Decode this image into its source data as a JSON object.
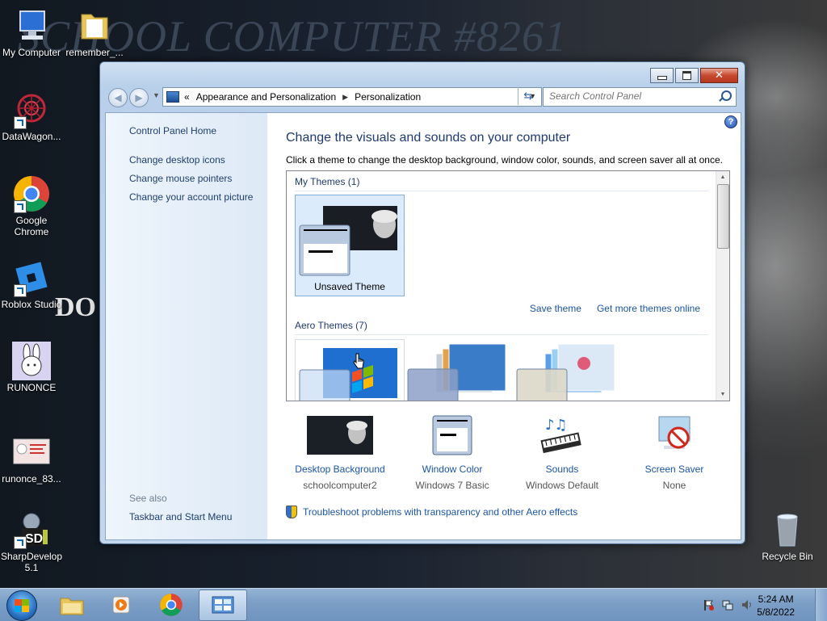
{
  "desktop": {
    "wallpaper_text": "SCHOOL COMPUTER #8261",
    "wallpaper_side_text": "DO",
    "icons": [
      {
        "label": "My Computer"
      },
      {
        "label": "remember_..."
      },
      {
        "label": "DataWagon..."
      },
      {
        "label": "Google Chrome"
      },
      {
        "label": "Roblox Studio"
      },
      {
        "label": "RUNONCE"
      },
      {
        "label": "runonce_83..."
      },
      {
        "label": "SharpDevelop 5.1"
      },
      {
        "label": "Recycle Bin"
      }
    ]
  },
  "window": {
    "breadcrumb": {
      "prefix": "«",
      "items": [
        "Appearance and Personalization",
        "Personalization"
      ]
    },
    "search_placeholder": "Search Control Panel",
    "help_glyph": "?",
    "left_nav": {
      "home": "Control Panel Home",
      "links": [
        "Change desktop icons",
        "Change mouse pointers",
        "Change your account picture"
      ],
      "see_also_title": "See also",
      "see_also": [
        "Taskbar and Start Menu"
      ]
    },
    "main": {
      "title": "Change the visuals and sounds on your computer",
      "subtitle": "Click a theme to change the desktop background, window color, sounds, and screen saver all at once.",
      "my_themes_label": "My Themes (1)",
      "my_themes": [
        {
          "name": "Unsaved Theme",
          "selected": true
        }
      ],
      "save_theme": "Save theme",
      "get_more": "Get more themes online",
      "aero_themes_label": "Aero Themes (7)",
      "bottom_items": [
        {
          "name": "Desktop Background",
          "value": "schoolcomputer2",
          "icon": "desktop-background-icon"
        },
        {
          "name": "Window Color",
          "value": "Windows 7 Basic",
          "icon": "window-color-icon"
        },
        {
          "name": "Sounds",
          "value": "Windows Default",
          "icon": "sounds-icon"
        },
        {
          "name": "Screen Saver",
          "value": "None",
          "icon": "screen-saver-icon"
        }
      ],
      "troubleshoot": "Troubleshoot problems with transparency and other Aero effects"
    }
  },
  "taskbar": {
    "time": "5:24 AM",
    "date": "5/8/2022",
    "pinned": [
      "windows-explorer-icon",
      "media-player-icon",
      "chrome-icon",
      "control-panel-icon"
    ],
    "active_index": 3
  },
  "colors": {
    "link": "#1a55a3",
    "heading": "#1e3a6e",
    "selected_tile": "#dcebfc"
  }
}
